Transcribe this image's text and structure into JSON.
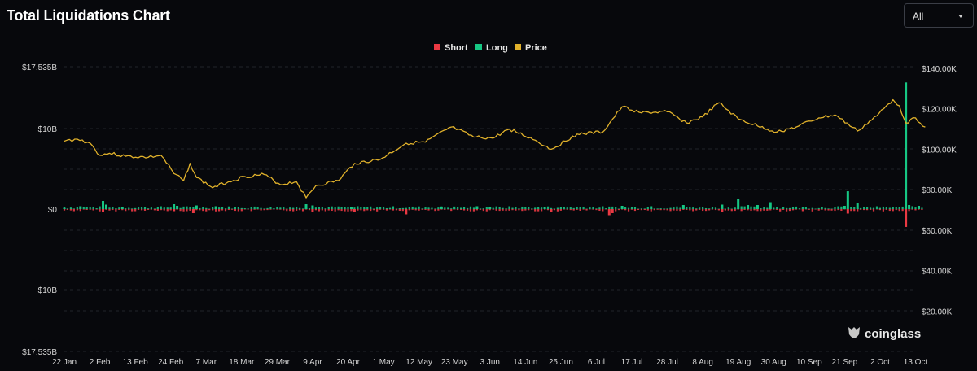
{
  "header": {
    "title": "Total Liquidations Chart",
    "range_select": {
      "value": "All",
      "icon": "chevron-down-icon"
    }
  },
  "watermark": {
    "text": "coinglass",
    "icon": "coinglass-logo-icon"
  },
  "colors": {
    "short": "#ea3943",
    "long": "#16c784",
    "price": "#e0b12b",
    "background": "#07080c"
  },
  "chart_data": {
    "type": "bar",
    "title": "Total Liquidations Chart",
    "legend": {
      "position": "top-center",
      "items": [
        "Short",
        "Long",
        "Price"
      ]
    },
    "x_ticks": [
      "22 Jan",
      "2 Feb",
      "13 Feb",
      "24 Feb",
      "7 Mar",
      "18 Mar",
      "29 Mar",
      "9 Apr",
      "20 Apr",
      "1 May",
      "12 May",
      "23 May",
      "3 Jun",
      "14 Jun",
      "25 Jun",
      "6 Jul",
      "17 Jul",
      "28 Jul",
      "8 Aug",
      "19 Aug",
      "30 Aug",
      "10 Sep",
      "21 Sep",
      "2 Oct",
      "13 Oct"
    ],
    "y_left_ticks": [
      "$17.535B",
      "$10B",
      "$0",
      "$10B",
      "$17.535B"
    ],
    "y_left_range": [
      -17.535,
      17.535
    ],
    "y_right_ticks": [
      "$140.00K",
      "$120.00K",
      "$100.00K",
      "$80.00K",
      "$60.00K",
      "$40.00K",
      "$20.00K"
    ],
    "y_right_range": [
      0,
      140000
    ],
    "grid": true,
    "series": [
      {
        "name": "Long",
        "unit": "billion USD",
        "points": [
          [
            "2025-01-22",
            0.15
          ],
          [
            "2025-01-27",
            0.35
          ],
          [
            "2025-02-03",
            1.0
          ],
          [
            "2025-02-04",
            0.55
          ],
          [
            "2025-02-09",
            0.2
          ],
          [
            "2025-02-25",
            0.6
          ],
          [
            "2025-02-26",
            0.4
          ],
          [
            "2025-03-04",
            0.45
          ],
          [
            "2025-03-10",
            0.35
          ],
          [
            "2025-04-07",
            0.6
          ],
          [
            "2025-04-09",
            0.45
          ],
          [
            "2025-04-21",
            0.2
          ],
          [
            "2025-05-19",
            0.25
          ],
          [
            "2025-05-30",
            0.35
          ],
          [
            "2025-06-03",
            0.25
          ],
          [
            "2025-06-20",
            0.3
          ],
          [
            "2025-07-14",
            0.4
          ],
          [
            "2025-07-23",
            0.35
          ],
          [
            "2025-08-02",
            0.5
          ],
          [
            "2025-08-14",
            0.55
          ],
          [
            "2025-08-19",
            1.3
          ],
          [
            "2025-08-22",
            0.5
          ],
          [
            "2025-08-25",
            0.5
          ],
          [
            "2025-08-29",
            0.85
          ],
          [
            "2025-09-21",
            0.4
          ],
          [
            "2025-09-22",
            2.2
          ],
          [
            "2025-09-25",
            0.7
          ],
          [
            "2025-10-10",
            15.6
          ],
          [
            "2025-10-11",
            0.5
          ],
          [
            "2025-10-14",
            0.4
          ]
        ]
      },
      {
        "name": "Short",
        "unit": "billion USD",
        "points": [
          [
            "2025-02-03",
            0.35
          ],
          [
            "2025-02-25",
            0.25
          ],
          [
            "2025-03-03",
            0.5
          ],
          [
            "2025-04-09",
            0.3
          ],
          [
            "2025-04-22",
            0.3
          ],
          [
            "2025-05-08",
            0.65
          ],
          [
            "2025-06-22",
            0.3
          ],
          [
            "2025-07-10",
            0.75
          ],
          [
            "2025-07-11",
            0.5
          ],
          [
            "2025-08-14",
            0.35
          ],
          [
            "2025-09-22",
            0.55
          ],
          [
            "2025-10-10",
            2.2
          ]
        ]
      },
      {
        "name": "Price",
        "unit": "USD",
        "points": [
          [
            "2025-01-22",
            104000
          ],
          [
            "2025-01-26",
            105000
          ],
          [
            "2025-01-30",
            103000
          ],
          [
            "2025-02-02",
            97000
          ],
          [
            "2025-02-05",
            98000
          ],
          [
            "2025-02-10",
            96500
          ],
          [
            "2025-02-17",
            96000
          ],
          [
            "2025-02-21",
            97000
          ],
          [
            "2025-02-25",
            88000
          ],
          [
            "2025-02-28",
            84500
          ],
          [
            "2025-03-02",
            93000
          ],
          [
            "2025-03-04",
            86000
          ],
          [
            "2025-03-09",
            81000
          ],
          [
            "2025-03-14",
            84000
          ],
          [
            "2025-03-19",
            86500
          ],
          [
            "2025-03-25",
            87500
          ],
          [
            "2025-03-30",
            82500
          ],
          [
            "2025-04-04",
            84000
          ],
          [
            "2025-04-07",
            76000
          ],
          [
            "2025-04-10",
            82000
          ],
          [
            "2025-04-17",
            84500
          ],
          [
            "2025-04-22",
            93000
          ],
          [
            "2025-04-30",
            95000
          ],
          [
            "2025-05-08",
            103000
          ],
          [
            "2025-05-14",
            103500
          ],
          [
            "2025-05-22",
            111000
          ],
          [
            "2025-05-29",
            106000
          ],
          [
            "2025-06-04",
            105500
          ],
          [
            "2025-06-09",
            110000
          ],
          [
            "2025-06-17",
            104500
          ],
          [
            "2025-06-22",
            100000
          ],
          [
            "2025-06-30",
            107500
          ],
          [
            "2025-07-08",
            108500
          ],
          [
            "2025-07-14",
            121000
          ],
          [
            "2025-07-20",
            118000
          ],
          [
            "2025-07-28",
            118500
          ],
          [
            "2025-08-03",
            113000
          ],
          [
            "2025-08-08",
            116000
          ],
          [
            "2025-08-13",
            123000
          ],
          [
            "2025-08-19",
            115000
          ],
          [
            "2025-08-25",
            111500
          ],
          [
            "2025-08-31",
            108500
          ],
          [
            "2025-09-06",
            111000
          ],
          [
            "2025-09-13",
            115500
          ],
          [
            "2025-09-18",
            117000
          ],
          [
            "2025-09-25",
            109000
          ],
          [
            "2025-10-01",
            116500
          ],
          [
            "2025-10-06",
            124500
          ],
          [
            "2025-10-08",
            121500
          ],
          [
            "2025-10-10",
            113000
          ],
          [
            "2025-10-13",
            115500
          ],
          [
            "2025-10-16",
            111000
          ]
        ]
      }
    ],
    "noise_bars": "many small daily long/short bars near zero (< $0.3B)"
  }
}
